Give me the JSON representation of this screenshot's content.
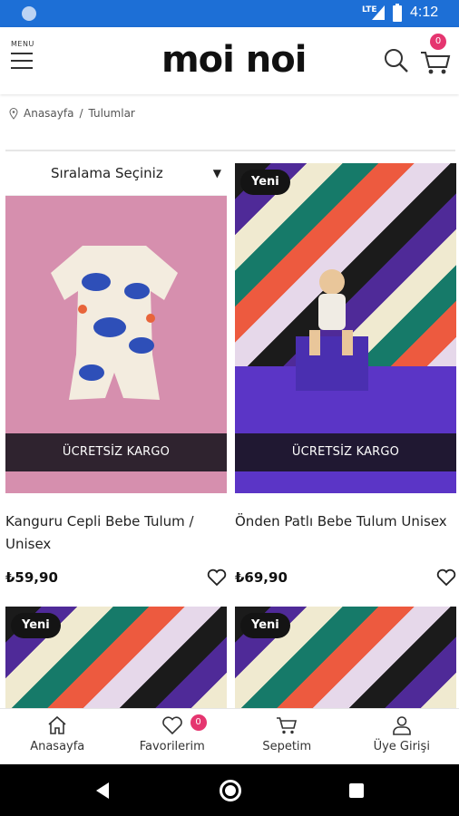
{
  "status_bar": {
    "network": "LTE",
    "time": "4:12"
  },
  "header": {
    "menu_label": "MENU",
    "logo": "moi noi",
    "cart_count": "0"
  },
  "breadcrumb": {
    "home": "Anasayfa",
    "separator": "/",
    "current": "Tulumlar"
  },
  "sort": {
    "label": "Sıralama Seçiniz"
  },
  "products": [
    {
      "title": "Kanguru Cepli Bebe Tulum / Unisex",
      "price": "₺59,90",
      "shipping": "ÜCRETSİZ KARGO",
      "badge": ""
    },
    {
      "title": "Önden Patlı Bebe Tulum Unisex",
      "price": "₺69,90",
      "shipping": "ÜCRETSİZ KARGO",
      "badge": "Yeni"
    },
    {
      "title": "",
      "price": "",
      "shipping": "",
      "badge": "Yeni"
    },
    {
      "title": "",
      "price": "",
      "shipping": "",
      "badge": "Yeni"
    }
  ],
  "bottom_nav": [
    {
      "label": "Anasayfa",
      "icon": "home-icon"
    },
    {
      "label": "Favorilerim",
      "icon": "heart-icon",
      "badge": "0"
    },
    {
      "label": "Sepetim",
      "icon": "cart-icon"
    },
    {
      "label": "Üye Girişi",
      "icon": "user-icon"
    }
  ],
  "colors": {
    "status_bar": "#1d6fd6",
    "badge": "#e5356f",
    "ship_bar": "#18141e"
  }
}
